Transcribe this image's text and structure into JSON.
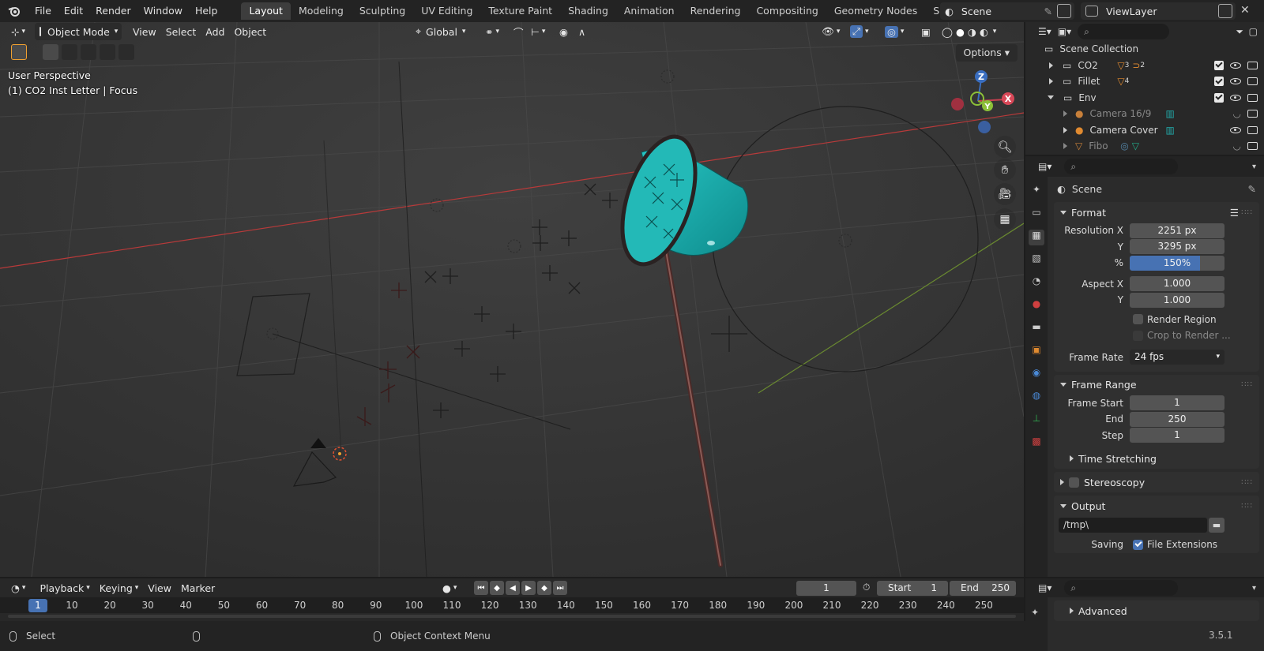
{
  "topbar": {
    "menus": [
      "File",
      "Edit",
      "Render",
      "Window",
      "Help"
    ],
    "workspaces": [
      "Layout",
      "Modeling",
      "Sculpting",
      "UV Editing",
      "Texture Paint",
      "Shading",
      "Animation",
      "Rendering",
      "Compositing",
      "Geometry Nodes",
      "Scripting"
    ],
    "active_workspace": "Layout",
    "scene_name": "Scene",
    "view_layer": "ViewLayer"
  },
  "viewport": {
    "mode": "Object Mode",
    "menus": [
      "View",
      "Select",
      "Add",
      "Object"
    ],
    "orientation": "Global",
    "perspective_label": "User Perspective",
    "active_object_label": "(1) CO2 Inst Letter | Focus",
    "options_label": "Options",
    "gizmo_axes": {
      "z": "Z",
      "y": "Y",
      "x": "X"
    },
    "colors": {
      "background": "#393939",
      "net_cyan": "#1aa9a8",
      "x_axis": "#b83a3a",
      "y_axis": "#6a8a30"
    }
  },
  "outliner": {
    "root": "Scene Collection",
    "rows": [
      {
        "name": "CO2",
        "sub": "3",
        "sub2": "2"
      },
      {
        "name": "Fillet",
        "sub": "4"
      },
      {
        "name": "Env"
      },
      {
        "name": "Camera 16/9"
      },
      {
        "name": "Camera Cover"
      },
      {
        "name": "Fibo"
      }
    ]
  },
  "properties": {
    "context": "Scene",
    "format": {
      "title": "Format",
      "resolution_x_label": "Resolution X",
      "resolution_x": "2251 px",
      "resolution_y_label": "Y",
      "resolution_y": "3295 px",
      "percent_label": "%",
      "percent": "150%",
      "percent_value": 0.74,
      "aspect_x_label": "Aspect X",
      "aspect_x": "1.000",
      "aspect_y_label": "Y",
      "aspect_y": "1.000",
      "render_region": "Render Region",
      "crop": "Crop to Render ...",
      "frame_rate_label": "Frame Rate",
      "frame_rate": "24 fps"
    },
    "frame_range": {
      "title": "Frame Range",
      "start_label": "Frame Start",
      "start": "1",
      "end_label": "End",
      "end": "250",
      "step_label": "Step",
      "step": "1",
      "time_stretching": "Time Stretching"
    },
    "stereoscopy": "Stereoscopy",
    "output": {
      "title": "Output",
      "path": "/tmp\\",
      "saving_label": "Saving",
      "file_extensions": "File Extensions"
    },
    "advanced": "Advanced"
  },
  "timeline": {
    "menus": [
      "Playback",
      "Keying",
      "View",
      "Marker"
    ],
    "current_frame": "1",
    "start_label": "Start",
    "start": "1",
    "end_label": "End",
    "end": "250",
    "ticks": [
      "10",
      "20",
      "30",
      "40",
      "50",
      "60",
      "70",
      "80",
      "90",
      "100",
      "110",
      "120",
      "130",
      "140",
      "150",
      "160",
      "170",
      "180",
      "190",
      "200",
      "210",
      "220",
      "230",
      "240",
      "250"
    ]
  },
  "statusbar": {
    "select": "Select",
    "context_menu": "Object Context Menu",
    "version": "3.5.1"
  }
}
